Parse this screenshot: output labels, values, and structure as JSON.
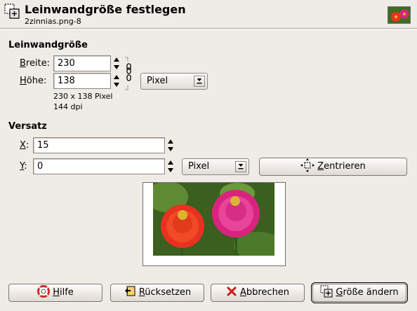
{
  "header": {
    "title": "Leinwandgröße festlegen",
    "subtitle": "2zinnias.png-8",
    "icon": "canvas-size-icon"
  },
  "canvas_size": {
    "section_title": "Leinwandgröße",
    "width_label_accel": "B",
    "width_label_rest": "reite:",
    "width_value": "230",
    "height_label_accel": "H",
    "height_label_rest": "öhe:",
    "height_value": "138",
    "unit": "Pixel",
    "info_size": "230 x 138 Pixel",
    "info_dpi": "144 dpi",
    "chain_linked": true
  },
  "offset": {
    "section_title": "Versatz",
    "x_label_accel": "X",
    "x_label_rest": ":",
    "x_value": "15",
    "y_label_accel": "Y",
    "y_label_rest": ":",
    "y_value": "0",
    "unit": "Pixel",
    "center_label_accel": "Z",
    "center_label_rest": "entrieren"
  },
  "buttons": {
    "help_accel": "H",
    "help_rest": "ilfe",
    "reset_accel": "R",
    "reset_rest": "ücksetzen",
    "cancel_accel": "A",
    "cancel_rest": "bbrechen",
    "resize_accel": "G",
    "resize_rest": "röße ändern"
  },
  "colors": {
    "background": "#efebe7",
    "flower_red": "#e8321f",
    "flower_pink": "#d9247f",
    "leaf_green": "#3f6b22"
  }
}
